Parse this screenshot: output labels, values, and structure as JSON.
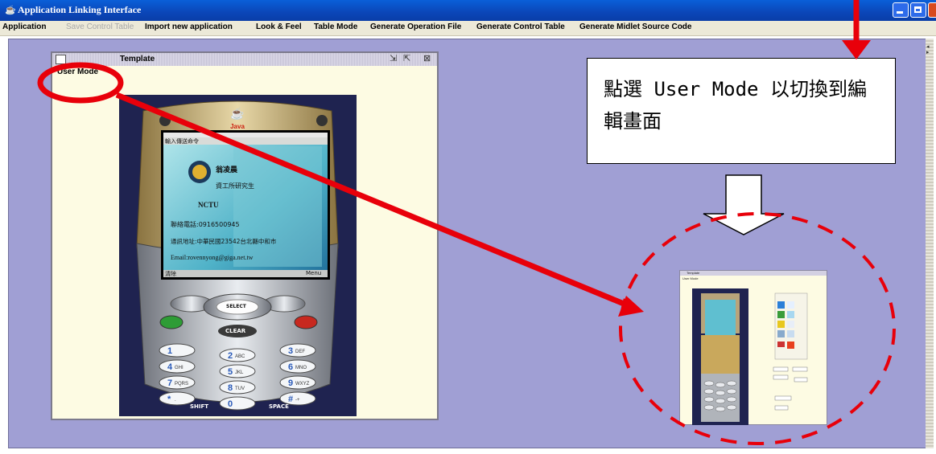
{
  "window": {
    "title": "Application Linking Interface",
    "colors": {
      "titlebar": "#0b46b8",
      "desktop": "#a09fd4",
      "annotation": "#e8000a"
    }
  },
  "menu": [
    {
      "label": "Application",
      "enabled": true
    },
    {
      "label": "Save Control Table",
      "enabled": false
    },
    {
      "label": "Import new application",
      "enabled": true
    },
    {
      "label": "Look & Feel",
      "enabled": true
    },
    {
      "label": "Table Mode",
      "enabled": true
    },
    {
      "label": "Generate Operation File",
      "enabled": true
    },
    {
      "label": "Generate Control Table",
      "enabled": true
    },
    {
      "label": "Generate Midlet Source Code",
      "enabled": true
    }
  ],
  "internal_frame": {
    "title": "Template",
    "mode_label": "User Mode",
    "controls": [
      "restore-icon",
      "maximize-icon",
      "close-icon"
    ]
  },
  "phone": {
    "brand": "Java",
    "screen": {
      "header": "輸入傳送命令",
      "name": "翁凌晨",
      "role": "資工所研究生",
      "org": "NCTU",
      "phone": "聯絡電話:0916500945",
      "address": "通訊地址:中華民國23542台北縣中和市",
      "email": "Email:rovennyong@giga.net.tw",
      "softkey_left": "清除",
      "softkey_right": "Menu"
    },
    "keys": {
      "select": "SELECT",
      "clear": "CLEAR",
      "shift": "SHIFT",
      "space": "SPACE",
      "pad": [
        {
          "d": "1",
          "l": ""
        },
        {
          "d": "2",
          "l": "ABC"
        },
        {
          "d": "3",
          "l": "DEF"
        },
        {
          "d": "4",
          "l": "GHI"
        },
        {
          "d": "5",
          "l": "JKL"
        },
        {
          "d": "6",
          "l": "MNO"
        },
        {
          "d": "7",
          "l": "PQRS"
        },
        {
          "d": "8",
          "l": "TUV"
        },
        {
          "d": "9",
          "l": "WXYZ"
        },
        {
          "d": "*",
          "l": "."
        },
        {
          "d": "0",
          "l": ""
        },
        {
          "d": "#",
          "l": "-+"
        }
      ]
    }
  },
  "annotation": {
    "callout_text": "點選 User Mode 以切換到編輯畫面"
  },
  "thumbnail": {
    "title": "Template",
    "mode_label": "User Mode"
  }
}
